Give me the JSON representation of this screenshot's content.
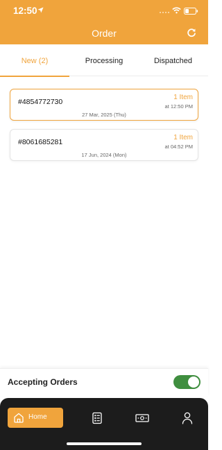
{
  "status_bar": {
    "time": "12:50"
  },
  "header": {
    "title": "Order"
  },
  "tabs": [
    {
      "label": "New (2)",
      "active": true
    },
    {
      "label": "Processing",
      "active": false
    },
    {
      "label": "Dispatched",
      "active": false
    }
  ],
  "orders": [
    {
      "id": "#4854772730",
      "items": "1 Item",
      "time": "at 12:50 PM",
      "date": "27 Mar, 2025 (Thu)",
      "selected": true
    },
    {
      "id": "#8061685281",
      "items": "1 Item",
      "time": "at 04:52 PM",
      "date": "17 Jun, 2024 (Mon)",
      "selected": false
    }
  ],
  "accepting": {
    "label": "Accepting Orders",
    "enabled": true
  },
  "bottom_nav": {
    "items": [
      {
        "label": "Home",
        "icon": "home-icon",
        "active": true
      },
      {
        "label": "",
        "icon": "orders-list-icon",
        "active": false
      },
      {
        "label": "",
        "icon": "cash-icon",
        "active": false
      },
      {
        "label": "",
        "icon": "profile-icon",
        "active": false
      }
    ]
  },
  "colors": {
    "accent": "#f0a43c",
    "toggle_on": "#3f8e3f",
    "nav_bg": "#1c1c1c"
  }
}
